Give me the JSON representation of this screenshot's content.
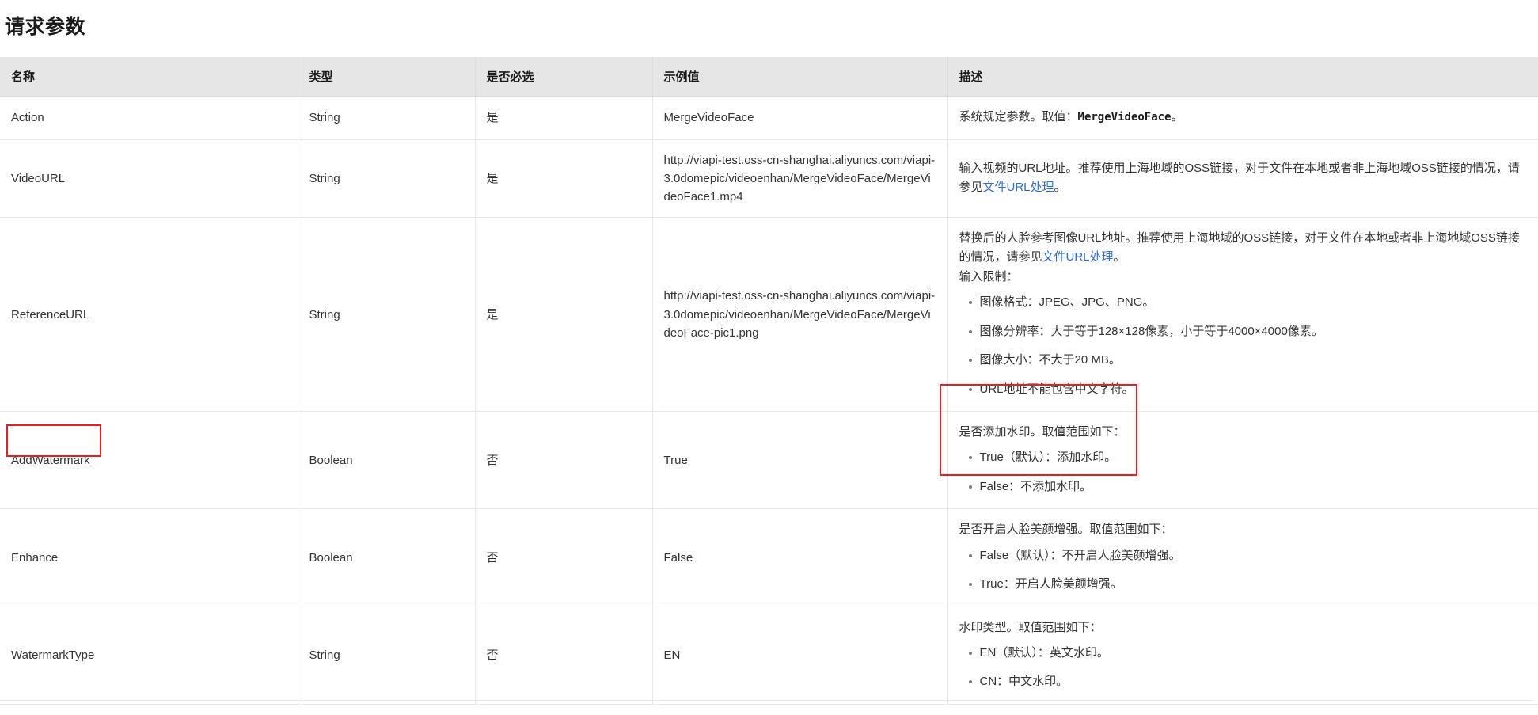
{
  "page_title": "请求参数",
  "accent": {
    "link_color": "#2f6bd6",
    "highlight_border": "#ee1c1c",
    "header_bg": "#e6e6e6"
  },
  "table": {
    "columns": [
      {
        "key": "name",
        "label": "名称"
      },
      {
        "key": "type",
        "label": "类型"
      },
      {
        "key": "required",
        "label": "是否必选"
      },
      {
        "key": "example",
        "label": "示例值"
      },
      {
        "key": "desc",
        "label": "描述"
      }
    ],
    "rows": [
      {
        "name": "Action",
        "type": "String",
        "required": "是",
        "example": "MergeVideoFace",
        "desc_lead_before": "系统规定参数。取值：",
        "desc_code": "MergeVideoFace",
        "desc_lead_after": "。",
        "bullets": []
      },
      {
        "name": "VideoURL",
        "type": "String",
        "required": "是",
        "example": "http://viapi-test.oss-cn-shanghai.aliyuncs.com/viapi-3.0domepic/videoenhan/MergeVideoFace/MergeVideoFace1.mp4",
        "desc_lead_before": "输入视频的URL地址。推荐使用上海地域的OSS链接，对于文件在本地或者非上海地域OSS链接的情况，请参见",
        "desc_link": "文件URL处理",
        "desc_lead_after": "。",
        "bullets": []
      },
      {
        "name": "ReferenceURL",
        "type": "String",
        "required": "是",
        "example": "http://viapi-test.oss-cn-shanghai.aliyuncs.com/viapi-3.0domepic/videoenhan/MergeVideoFace/MergeVideoFace-pic1.png",
        "desc_lead_before": "替换后的人脸参考图像URL地址。推荐使用上海地域的OSS链接，对于文件在本地或者非上海地域OSS链接的情况，请参见",
        "desc_link": "文件URL处理",
        "desc_lead_after": "。",
        "desc_line2": "输入限制：",
        "bullets": [
          "图像格式：JPEG、JPG、PNG。",
          "图像分辨率：大于等于128×128像素，小于等于4000×4000像素。",
          "图像大小：不大于20 MB。",
          "URL地址不能包含中文字符。"
        ]
      },
      {
        "name": "AddWatermark",
        "type": "Boolean",
        "required": "否",
        "example": "True",
        "desc_lead_before": "是否添加水印。取值范围如下：",
        "bullets": [
          "True（默认）：添加水印。",
          "False：不添加水印。"
        ]
      },
      {
        "name": "Enhance",
        "type": "Boolean",
        "required": "否",
        "example": "False",
        "desc_lead_before": "是否开启人脸美颜增强。取值范围如下：",
        "bullets": [
          "False（默认）：不开启人脸美颜增强。",
          "True：开启人脸美颜增强。"
        ]
      },
      {
        "name": "WatermarkType",
        "type": "String",
        "required": "否",
        "example": "EN",
        "desc_lead_before": "水印类型。取值范围如下：",
        "bullets": [
          "EN（默认）：英文水印。",
          "CN：中文水印。"
        ]
      }
    ]
  },
  "annotations": [
    {
      "id": "hl-name",
      "target": "AddWatermark 参数名称"
    },
    {
      "id": "hl-desc",
      "target": "AddWatermark 描述取值范围"
    }
  ]
}
